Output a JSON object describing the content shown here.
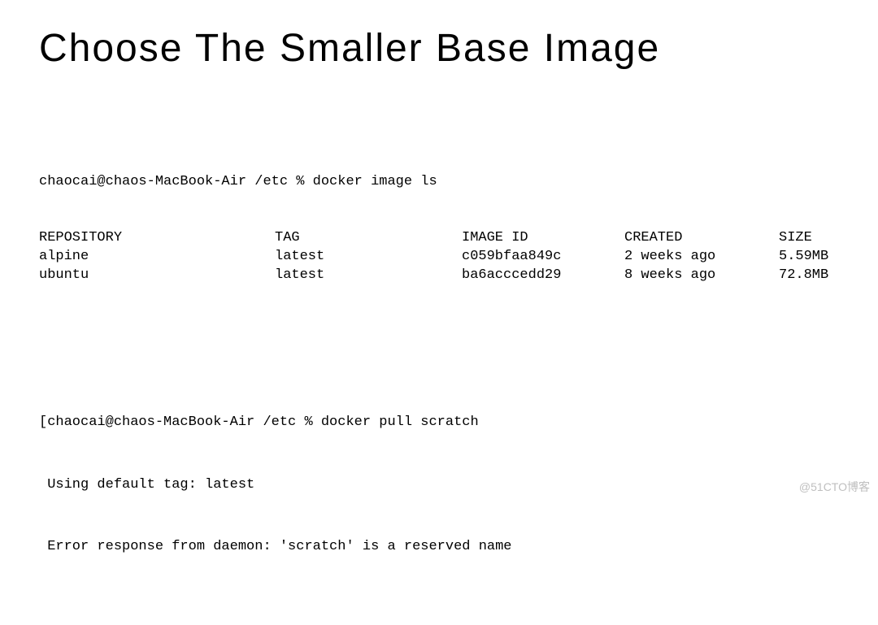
{
  "title": "Choose The Smaller Base Image",
  "block1": {
    "prompt": "chaocai@chaos-MacBook-Air /etc % docker image ls",
    "headers": {
      "repository": "REPOSITORY",
      "tag": "TAG",
      "image_id": "IMAGE ID",
      "created": "CREATED",
      "size": "SIZE"
    },
    "rows": [
      {
        "repository": "alpine",
        "tag": "latest",
        "image_id": "c059bfaa849c",
        "created": "2 weeks ago",
        "size": "5.59MB"
      },
      {
        "repository": "ubuntu",
        "tag": "latest",
        "image_id": "ba6acccedd29",
        "created": "8 weeks ago",
        "size": "72.8MB"
      }
    ]
  },
  "block2": {
    "line1": "[chaocai@chaos-MacBook-Air /etc % docker pull scratch",
    "line2": " Using default tag: latest",
    "line3": " Error response from daemon: 'scratch' is a reserved name"
  },
  "watermark": "@51CTO博客"
}
